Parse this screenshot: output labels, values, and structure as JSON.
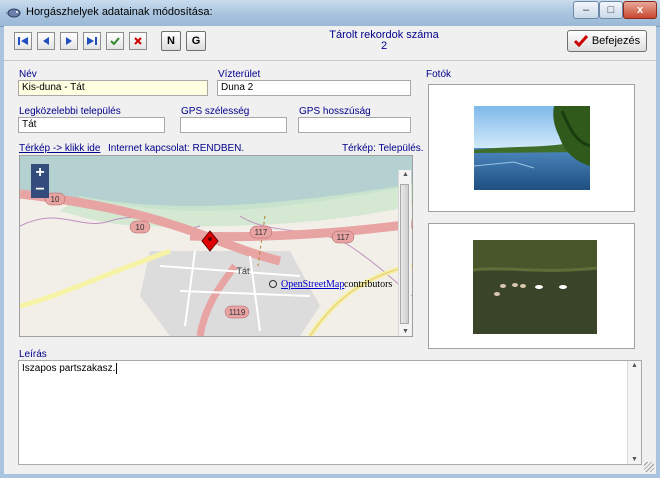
{
  "window": {
    "title": "Horgászhelyek adatainak módosítása:",
    "minimize": "–",
    "maximize": "□",
    "close": "x"
  },
  "toolbar": {
    "n_label": "N",
    "g_label": "G",
    "record_count_label": "Tárolt rekordok száma",
    "record_count": "2",
    "finish_label": "Befejezés"
  },
  "form": {
    "name_label": "Név",
    "name_value": "Kis-duna - Tát",
    "water_label": "Vízterület",
    "water_value": "Duna 2",
    "settlement_label": "Legközelebbi település",
    "settlement_value": "Tát",
    "gps_lat_label": "GPS szélesség",
    "gps_lat_value": "",
    "gps_lon_label": "GPS hosszúság",
    "gps_lon_value": "",
    "photos_label": "Fotók",
    "map_link": "Térkép -> klikk ide",
    "internet_status": "Internet kapcsolat: RENDBEN.",
    "map_mode": "Térkép: Település.",
    "desc_label": "Leírás",
    "desc_value": "Iszapos partszakasz."
  },
  "map": {
    "zoom_in": "+",
    "zoom_out": "−",
    "road_10": "10",
    "road_10b": "10",
    "road_117": "117",
    "road_117b": "117",
    "road_1119": "1119",
    "town": "Tát",
    "attribution_link": "OpenStreetMap",
    "attribution_suffix": " contributors"
  },
  "colors": {
    "label": "#00008b",
    "accent_check": "#cc0000",
    "nav_blue": "#1f4fbf",
    "ok_green": "#2e8b2e"
  }
}
